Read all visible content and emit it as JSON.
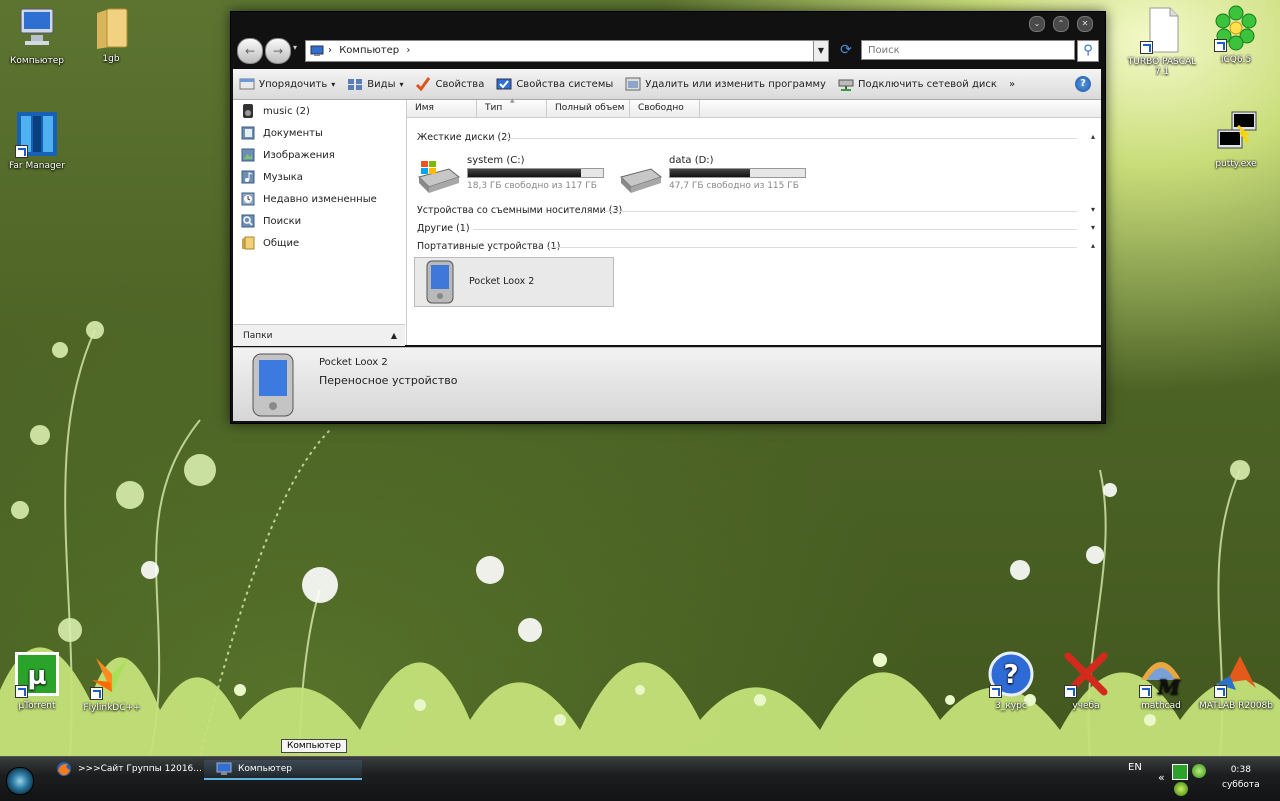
{
  "desktop": {
    "icons_left": [
      {
        "label": "Компьютер",
        "icon": "computer-icon"
      },
      {
        "label": "1gb",
        "icon": "folder-icon"
      },
      {
        "label": "Far Manager",
        "icon": "far-manager-icon"
      }
    ],
    "icons_right": [
      {
        "label": "TURBO PASCAL 7.1",
        "icon": "document-icon"
      },
      {
        "label": "ICQ6.5",
        "icon": "icq-flower-icon"
      },
      {
        "label": "putty.exe",
        "icon": "putty-icon"
      }
    ],
    "icons_bottom": [
      {
        "label": "µTorrent",
        "icon": "utorrent-icon"
      },
      {
        "label": "FlylinkDC++",
        "icon": "flylink-icon"
      },
      {
        "label": "3_курс",
        "icon": "help-question-icon"
      },
      {
        "label": "учеба",
        "icon": "red-x-icon"
      },
      {
        "label": "mathcad",
        "icon": "mathcad-icon"
      },
      {
        "label": "MATLAB R2008b",
        "icon": "matlab-icon"
      }
    ]
  },
  "window": {
    "controls": [
      "⌄",
      "⌃",
      "✕"
    ],
    "address": {
      "path": [
        "Компьютер"
      ],
      "separator": "›"
    },
    "search_placeholder": "Поиск",
    "toolbar": [
      {
        "label": "Упорядочить",
        "dropdown": true,
        "icon": "organize-icon"
      },
      {
        "label": "Виды",
        "dropdown": true,
        "icon": "views-icon"
      },
      {
        "label": "Свойства",
        "dropdown": false,
        "icon": "checkmark-icon"
      },
      {
        "label": "Свойства системы",
        "dropdown": false,
        "icon": "system-properties-icon"
      },
      {
        "label": "Удалить или изменить программу",
        "dropdown": false,
        "icon": "programs-icon"
      },
      {
        "label": "Подключить сетевой диск",
        "dropdown": false,
        "icon": "network-drive-icon"
      }
    ],
    "toolbar_more": "»",
    "help_label": "?",
    "nav": [
      {
        "label": "music (2)",
        "icon": "speaker-icon"
      },
      {
        "label": "Документы",
        "icon": "documents-icon"
      },
      {
        "label": "Изображения",
        "icon": "pictures-icon"
      },
      {
        "label": "Музыка",
        "icon": "music-icon"
      },
      {
        "label": "Недавно измененные",
        "icon": "recent-icon"
      },
      {
        "label": "Поиски",
        "icon": "searches-icon"
      },
      {
        "label": "Общие",
        "icon": "public-folder-icon"
      }
    ],
    "folders_label": "Папки",
    "columns": [
      "Имя",
      "Тип",
      "Полный объем",
      "Свободно"
    ],
    "groups": {
      "hard_disks": "Жесткие диски (2)",
      "removable": "Устройства со съемными носителями (3)",
      "other": "Другие (1)",
      "portable": "Портативные устройства (1)"
    },
    "drives": [
      {
        "name": "system (C:)",
        "free_text": "18,3 ГБ свободно из 117 ГБ",
        "used_fraction": 0.84
      },
      {
        "name": "data (D:)",
        "free_text": "47,7 ГБ свободно из 115 ГБ",
        "used_fraction": 0.59
      }
    ],
    "device": {
      "name": "Pocket Loox 2"
    },
    "details": {
      "title": "Pocket Loox 2",
      "subtitle": "Переносное устройство"
    }
  },
  "taskbar": {
    "items": [
      {
        "label": ">>>Сайт Группы 12016...",
        "icon": "firefox-icon"
      },
      {
        "label": "Компьютер",
        "icon": "computer-icon"
      }
    ],
    "tooltip": "Компьютер",
    "lang": "EN",
    "tray_expand": "«",
    "time": "0:38",
    "day": "суббота"
  }
}
